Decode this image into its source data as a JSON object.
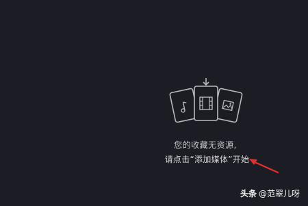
{
  "media_panel": {
    "empty_title": "您的收藏无资源,",
    "empty_hint": "请点击“添加媒体”开始",
    "icons": [
      "music-card-icon",
      "video-film-card-icon",
      "image-card-icon",
      "download-arrow-icon"
    ]
  },
  "annotation": {
    "arrow_color": "#e03030"
  },
  "watermark": {
    "brand": "头条",
    "handle": "@范翠儿呀"
  },
  "colors": {
    "background": "#1c1c24",
    "icon_stroke": "#b8b8bc",
    "text": "#c8c8cc"
  }
}
